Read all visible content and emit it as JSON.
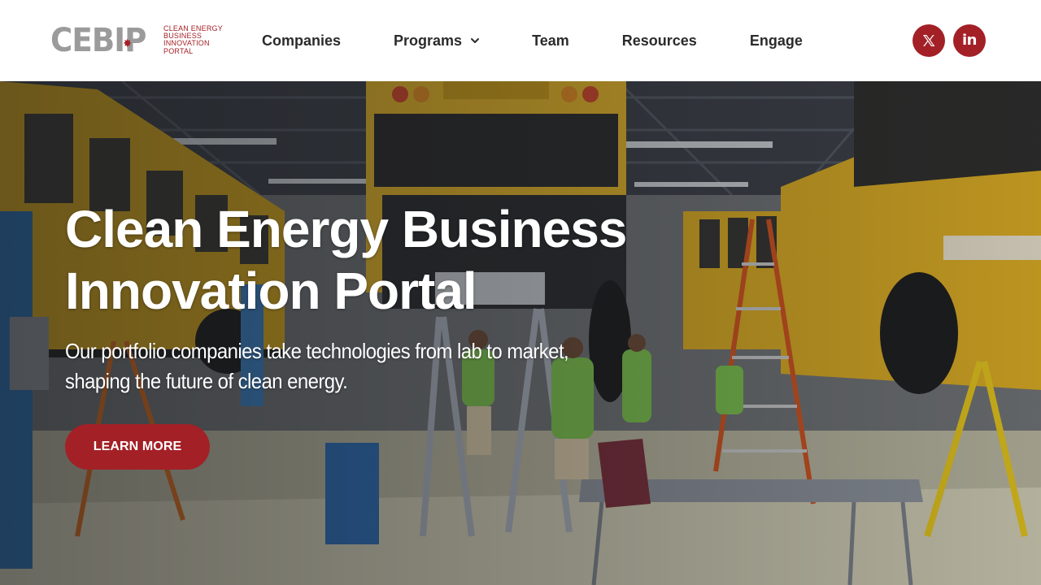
{
  "brand": {
    "logo_text": "CEBIP",
    "tagline": [
      "CLEAN ENERGY",
      "BUSINESS",
      "INNOVATION",
      "PORTAL"
    ],
    "accent_color": "#a32027",
    "logo_gray": "#9b9b9b"
  },
  "nav": {
    "items": [
      {
        "label": "Companies"
      },
      {
        "label": "Programs",
        "has_dropdown": true
      },
      {
        "label": "Team"
      },
      {
        "label": "Resources"
      },
      {
        "label": "Engage"
      }
    ]
  },
  "social": {
    "x_icon": "x-twitter-icon",
    "linkedin_icon": "linkedin-icon",
    "linkedin_text": "in"
  },
  "hero": {
    "title": "Clean Energy Business Innovation Portal",
    "subtitle": "Our portfolio companies take technologies from lab to market, shaping the future of clean energy.",
    "cta_label": "LEARN MORE",
    "background_image": "workshop with yellow school buses on lifts and technicians in green shirts"
  }
}
